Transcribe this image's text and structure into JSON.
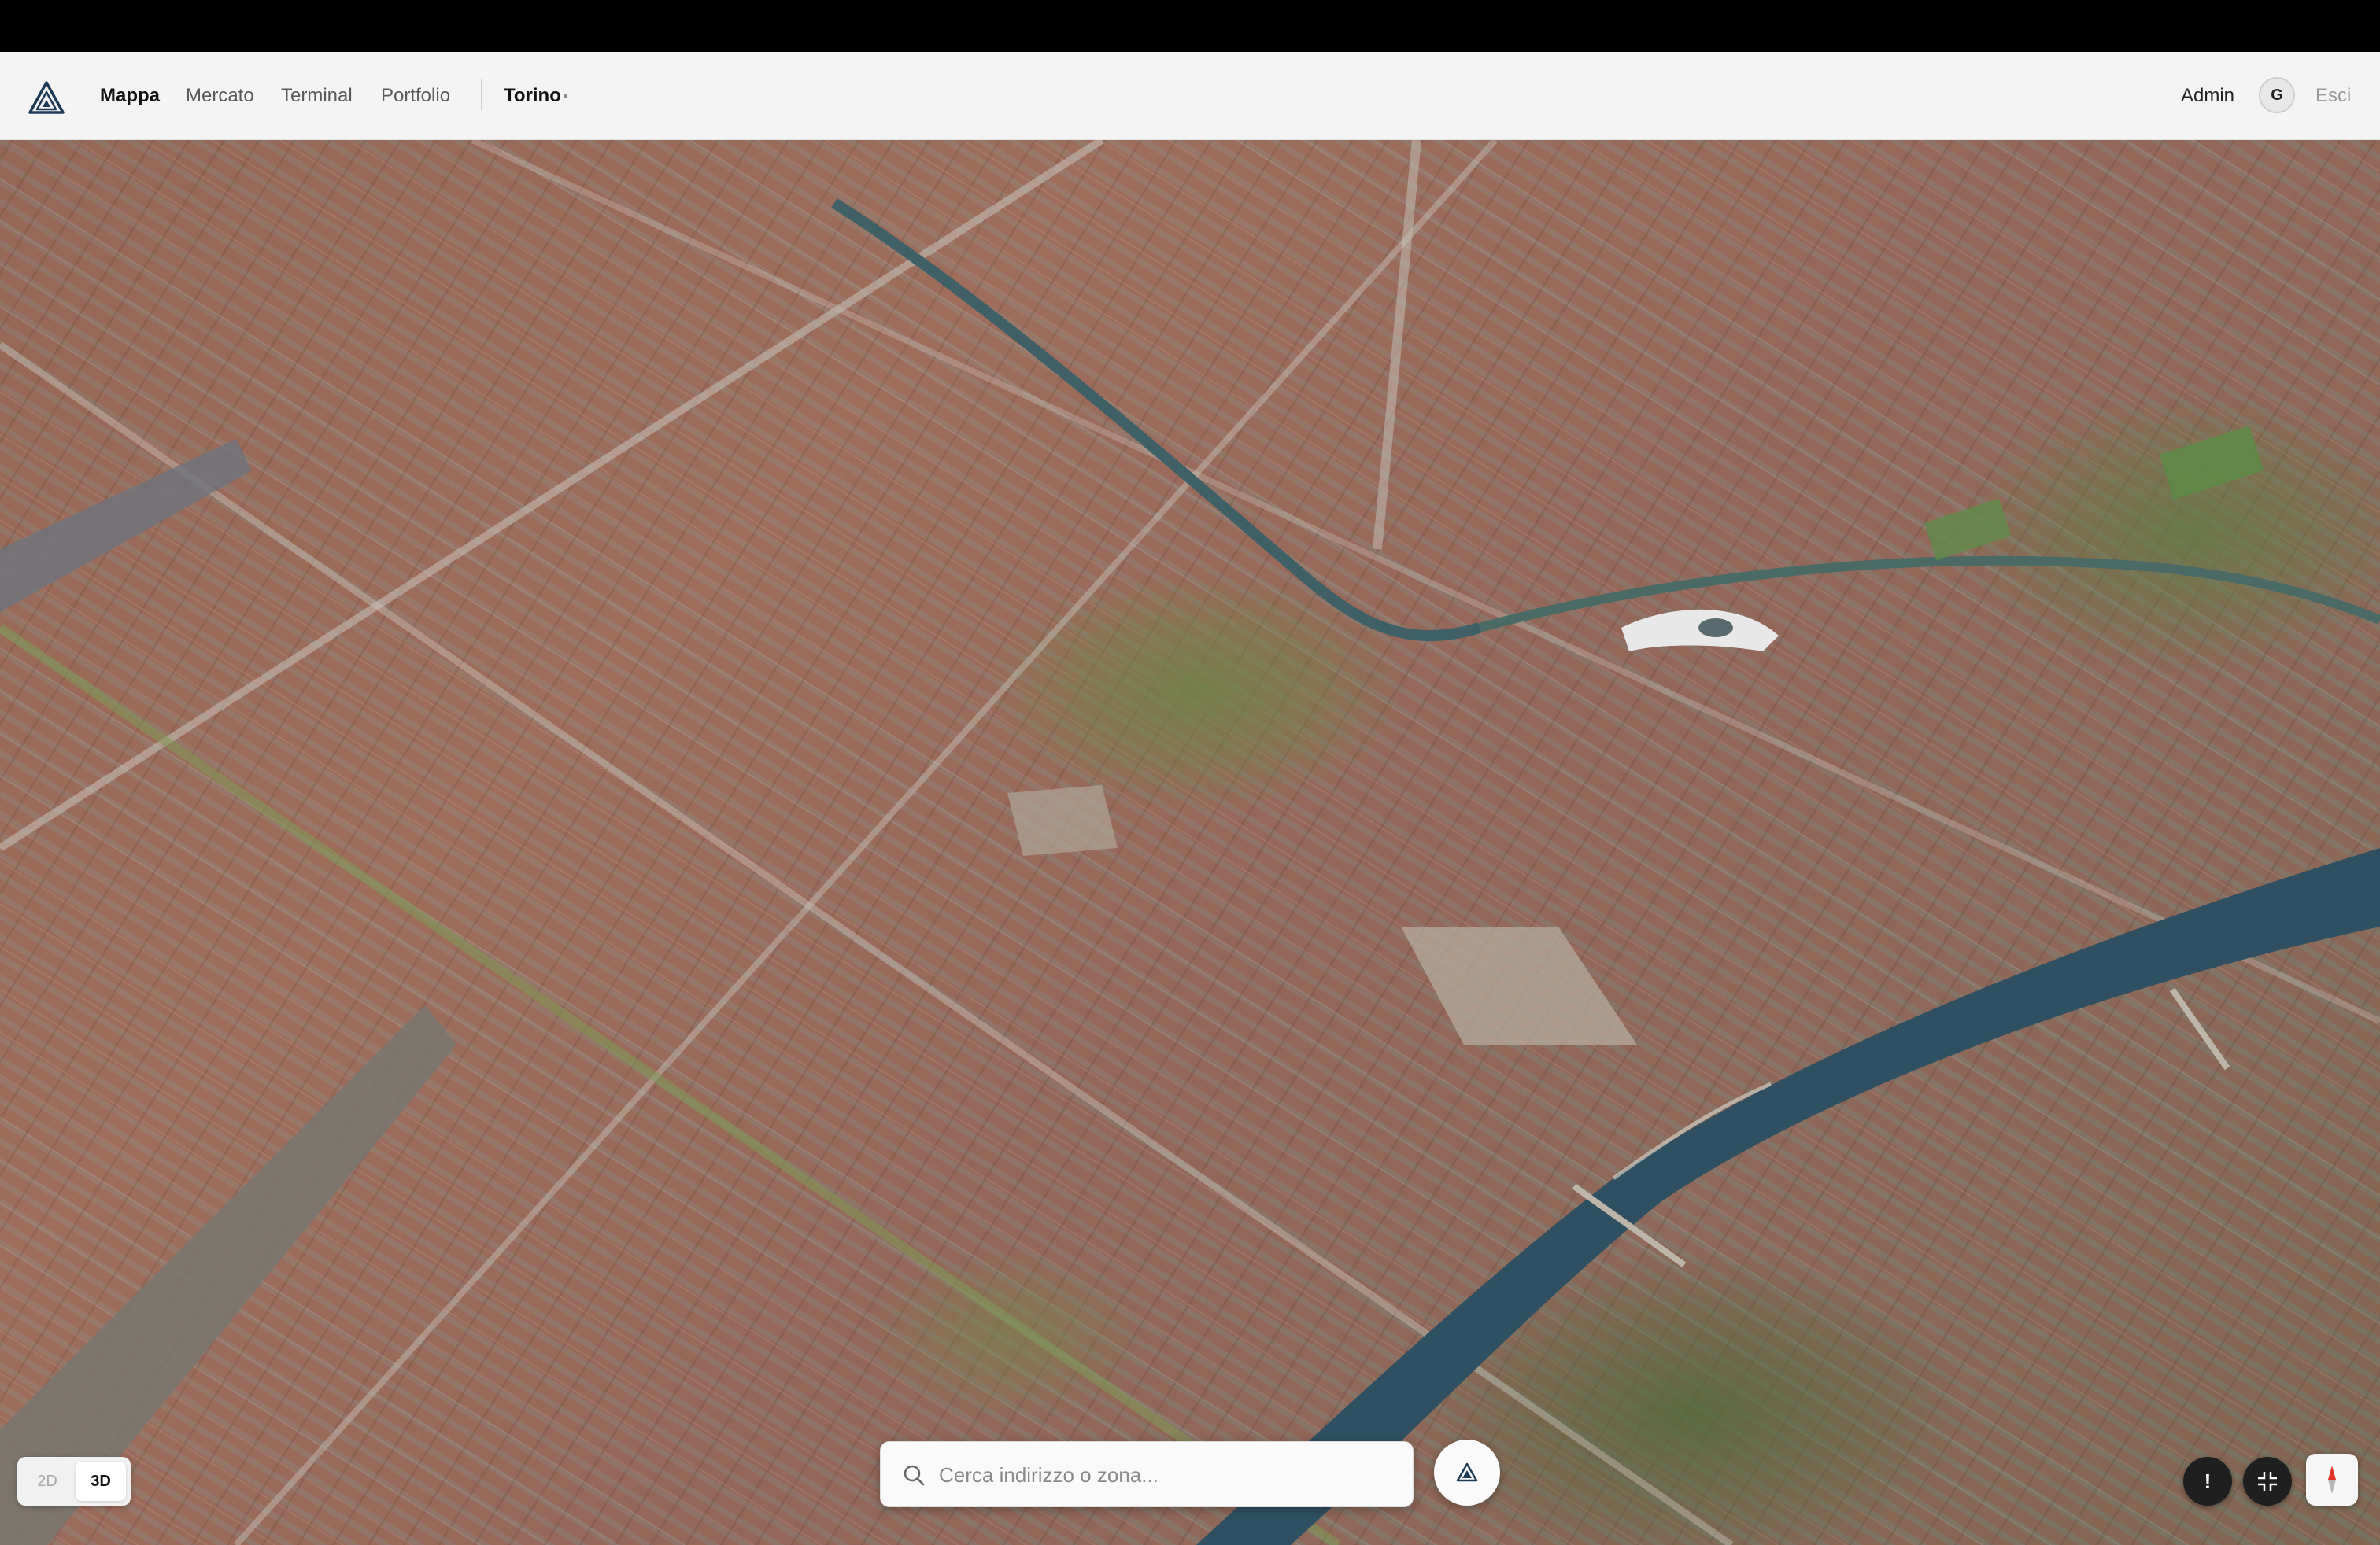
{
  "nav": {
    "logo_icon": "app-logo-triangle-icon",
    "items": [
      {
        "label": "Mappa",
        "active": true
      },
      {
        "label": "Mercato",
        "active": false
      },
      {
        "label": "Terminal",
        "active": false
      },
      {
        "label": "Portfolio",
        "active": false
      }
    ],
    "city": "Torino",
    "user_label": "Admin",
    "avatar_initial": "G",
    "logout_label": "Esci"
  },
  "map": {
    "mode_options": [
      "2D",
      "3D"
    ],
    "active_mode": "3D"
  },
  "search": {
    "placeholder": "Cerca indirizzo o zona...",
    "value": ""
  },
  "controls": {
    "info_label": "!",
    "icons": [
      "search-icon",
      "locate-logo-icon",
      "exit-fullscreen-icon",
      "compass-icon"
    ]
  },
  "colors": {
    "navbar_bg": "#f4f4f4",
    "river": "#2f4f63",
    "button_dark": "#1f1f1f"
  }
}
